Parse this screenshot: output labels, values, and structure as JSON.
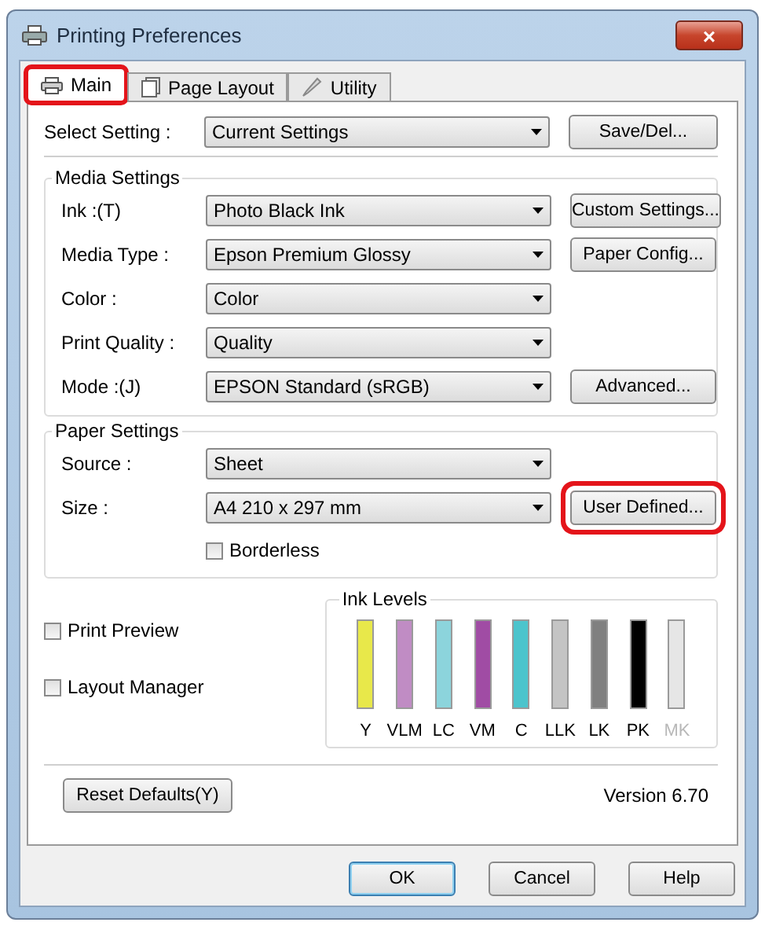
{
  "window": {
    "title": "Printing Preferences",
    "close": "×"
  },
  "tabs": [
    {
      "label": "Main",
      "selected": true,
      "highlighted": true
    },
    {
      "label": "Page Layout",
      "selected": false,
      "highlighted": false
    },
    {
      "label": "Utility",
      "selected": false,
      "highlighted": false
    }
  ],
  "select_setting": {
    "label": "Select Setting :",
    "value": "Current Settings",
    "button": {
      "label": "Save/Del...",
      "highlighted": false
    }
  },
  "media_settings": {
    "title": "Media Settings",
    "rows": [
      {
        "label": "Ink :(T)",
        "value": "Photo Black Ink",
        "button": {
          "label": "Custom Settings...",
          "highlighted": false
        }
      },
      {
        "label": "Media Type :",
        "value": "Epson Premium Glossy",
        "button": {
          "label": "Paper Config...",
          "highlighted": false
        }
      },
      {
        "label": "Color :",
        "value": "Color"
      },
      {
        "label": "Print Quality :",
        "value": "Quality"
      },
      {
        "label": "Mode :(J)",
        "value": "EPSON Standard (sRGB)",
        "button": {
          "label": "Advanced...",
          "highlighted": false
        }
      }
    ]
  },
  "paper_settings": {
    "title": "Paper Settings",
    "rows": [
      {
        "label": "Source :",
        "value": "Sheet"
      },
      {
        "label": "Size :",
        "value": "A4 210 x 297 mm",
        "button": {
          "label": "User Defined...",
          "highlighted": true
        }
      }
    ],
    "borderless": {
      "label": "Borderless",
      "checked": false
    }
  },
  "options": [
    {
      "label": "Print Preview",
      "checked": false
    },
    {
      "label": "Layout Manager",
      "checked": false
    }
  ],
  "ink_levels": {
    "title": "Ink Levels",
    "inks": [
      {
        "label": "Y",
        "color": "#e8e84a",
        "level": 1,
        "disabled": false
      },
      {
        "label": "VLM",
        "color": "#c08cc4",
        "level": 1,
        "disabled": false
      },
      {
        "label": "LC",
        "color": "#8cd4dc",
        "level": 1,
        "disabled": false
      },
      {
        "label": "VM",
        "color": "#a04ca4",
        "level": 1,
        "disabled": false
      },
      {
        "label": "C",
        "color": "#4cc4cc",
        "level": 1,
        "disabled": false
      },
      {
        "label": "LLK",
        "color": "#c4c4c4",
        "level": 1,
        "disabled": false
      },
      {
        "label": "LK",
        "color": "#808080",
        "level": 1,
        "disabled": false
      },
      {
        "label": "PK",
        "color": "#000000",
        "level": 1,
        "disabled": false
      },
      {
        "label": "MK",
        "color": "#e6e6e6",
        "level": 1,
        "disabled": true
      }
    ]
  },
  "reset_button": "Reset Defaults(Y)",
  "version": "Version 6.70",
  "footer_buttons": [
    {
      "label": "OK",
      "default": true
    },
    {
      "label": "Cancel",
      "default": false
    },
    {
      "label": "Help",
      "default": false
    }
  ]
}
